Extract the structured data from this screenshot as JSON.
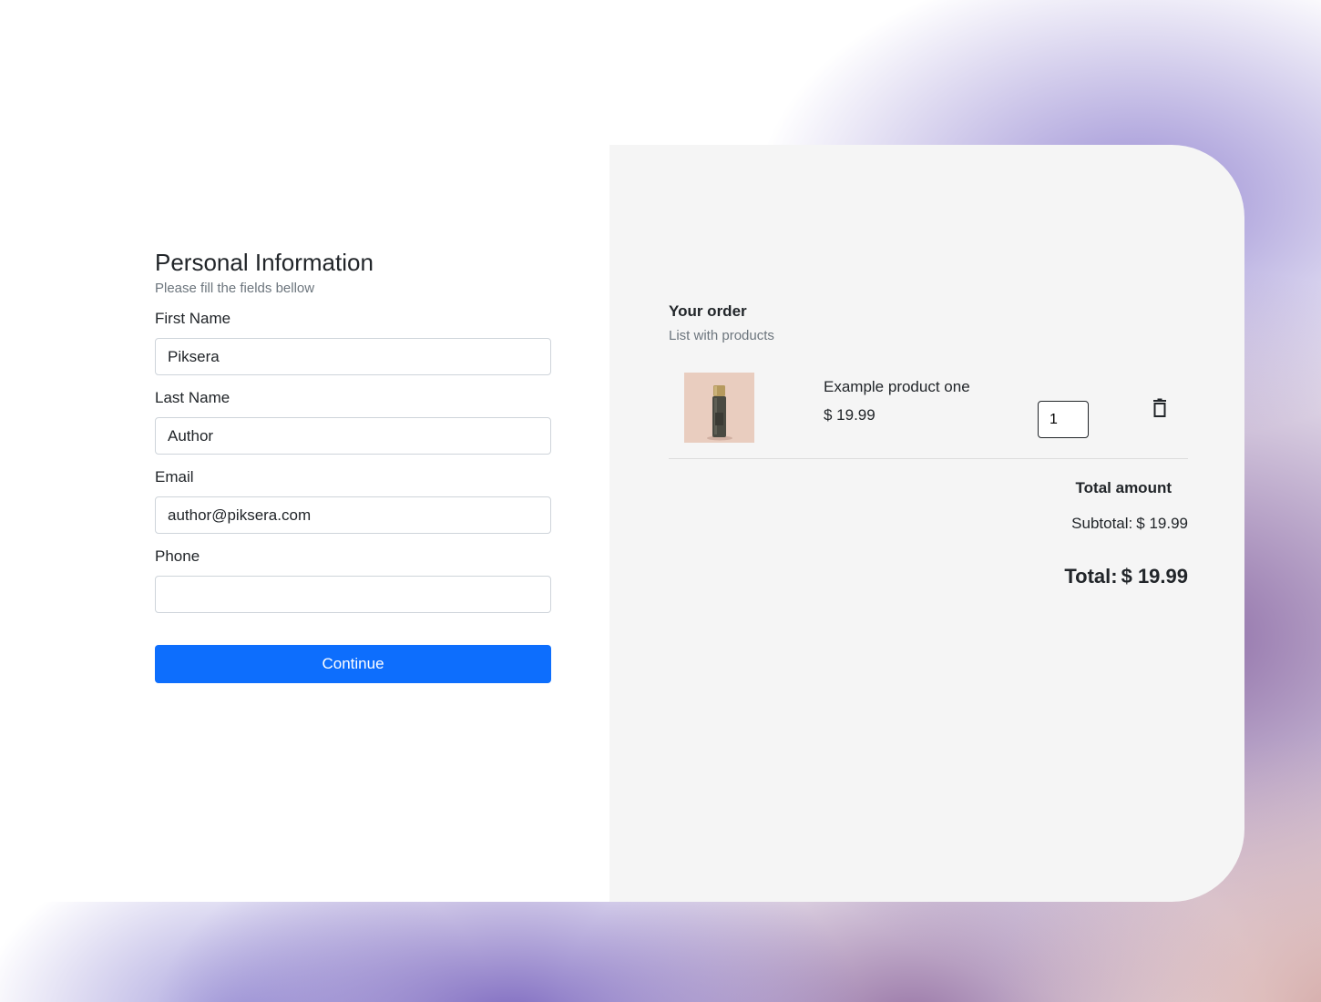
{
  "personal_info": {
    "title": "Personal Information",
    "subtitle": "Please fill the fields bellow",
    "fields": [
      {
        "label": "First Name",
        "value": "Piksera"
      },
      {
        "label": "Last Name",
        "value": "Author"
      },
      {
        "label": "Email",
        "value": "author@piksera.com"
      },
      {
        "label": "Phone",
        "value": ""
      }
    ],
    "continue_label": "Continue"
  },
  "order": {
    "title": "Your order",
    "subtitle": "List with products",
    "items": [
      {
        "name": "Example product one",
        "price": "$ 19.99",
        "quantity": "1"
      }
    ],
    "totals_title": "Total amount",
    "subtotal_label": "Subtotal:",
    "subtotal_value": "$ 19.99",
    "total_label": "Total:",
    "total_value": "$ 19.99"
  },
  "icons": {
    "delete": "trash-icon"
  },
  "colors": {
    "primary": "#0d6efd",
    "panel_bg": "#f5f5f5",
    "muted_text": "#6c757d"
  }
}
